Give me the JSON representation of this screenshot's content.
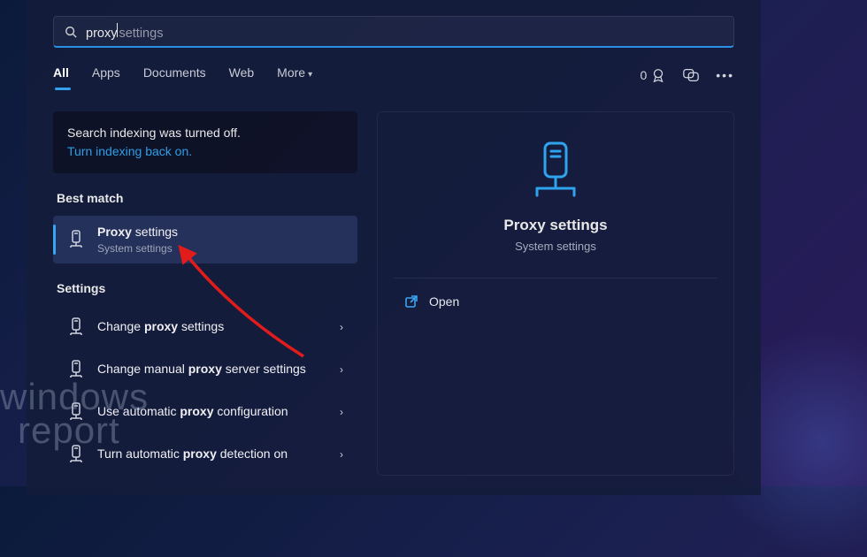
{
  "search": {
    "typed": "proxy",
    "suggested_rest": " settings"
  },
  "tabs": {
    "items": [
      "All",
      "Apps",
      "Documents",
      "Web",
      "More"
    ],
    "active_index": 0
  },
  "toolbar": {
    "rewards_count": "0"
  },
  "indexing": {
    "message": "Search indexing was turned off.",
    "link": "Turn indexing back on."
  },
  "sections": {
    "best_match": "Best match",
    "settings": "Settings"
  },
  "results": {
    "best": {
      "title_pre": "Proxy",
      "title_post": " settings",
      "subtitle": "System settings"
    },
    "settings": [
      {
        "pre": "Change ",
        "bold": "proxy",
        "post": " settings"
      },
      {
        "pre": "Change manual ",
        "bold": "proxy",
        "post": " server settings"
      },
      {
        "pre": "Use automatic ",
        "bold": "proxy",
        "post": " configuration"
      },
      {
        "pre": "Turn automatic ",
        "bold": "proxy",
        "post": " detection on"
      }
    ]
  },
  "preview": {
    "title": "Proxy settings",
    "subtitle": "System settings",
    "actions": {
      "open": "Open"
    }
  },
  "watermark": {
    "line1": "windows",
    "line2": "report"
  }
}
